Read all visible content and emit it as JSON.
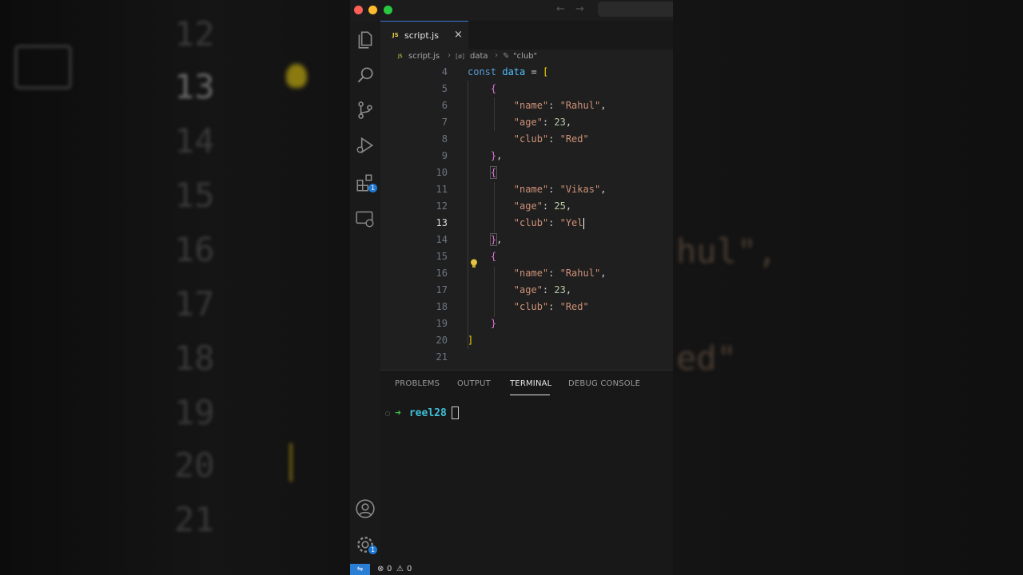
{
  "background": {
    "line_numbers": [
      "12",
      "13",
      "14",
      "15",
      "16",
      "17",
      "18",
      "19",
      "20",
      "21"
    ],
    "fragments": [
      "hul\",",
      "ed\""
    ]
  },
  "window": {
    "tab": {
      "icon_label": "JS",
      "file": "script.js",
      "close": "×"
    },
    "breadcrumb": {
      "file": "script.js",
      "symbol_1": "data",
      "symbol_2": "\"club\""
    },
    "code_lines": [
      {
        "n": "4",
        "active": false
      },
      {
        "n": "5",
        "active": false
      },
      {
        "n": "6",
        "active": false
      },
      {
        "n": "7",
        "active": false
      },
      {
        "n": "8",
        "active": false
      },
      {
        "n": "9",
        "active": false
      },
      {
        "n": "10",
        "active": false
      },
      {
        "n": "11",
        "active": false
      },
      {
        "n": "12",
        "active": false
      },
      {
        "n": "13",
        "active": true
      },
      {
        "n": "14",
        "active": false
      },
      {
        "n": "15",
        "active": false
      },
      {
        "n": "16",
        "active": false
      },
      {
        "n": "17",
        "active": false
      },
      {
        "n": "18",
        "active": false
      },
      {
        "n": "19",
        "active": false
      },
      {
        "n": "20",
        "active": false
      },
      {
        "n": "21",
        "active": false
      }
    ],
    "code": {
      "l4": {
        "kw": "const",
        "var": "data",
        "op": " = ",
        "br": "["
      },
      "l6": {
        "key": "\"name\"",
        "val": "\"Rahul\""
      },
      "l7": {
        "key": "\"age\"",
        "val": "23"
      },
      "l8": {
        "key": "\"club\"",
        "val": "\"Red\""
      },
      "l11": {
        "key": "\"name\"",
        "val": "\"Vikas\""
      },
      "l12": {
        "key": "\"age\"",
        "val": "25"
      },
      "l13": {
        "key": "\"club\"",
        "val": "\"Yel"
      },
      "l16": {
        "key": "\"name\"",
        "val": "\"Rahul\""
      },
      "l17": {
        "key": "\"age\"",
        "val": "23"
      },
      "l18": {
        "key": "\"club\"",
        "val": "\"Red\""
      }
    },
    "panel_tabs": [
      "PROBLEMS",
      "OUTPUT",
      "TERMINAL",
      "DEBUG CONSOLE"
    ],
    "active_panel_tab": "TERMINAL",
    "terminal": {
      "dot": "○",
      "arrow": "➜",
      "directory": "reel28"
    },
    "status": {
      "errors": "0",
      "warnings": "0"
    },
    "colors": {
      "accent": "#2a7fd4",
      "string": "#ce9178",
      "keyword": "#569cd6",
      "variable": "#4fc1ff"
    },
    "icons": [
      "explorer-icon",
      "search-icon",
      "source-control-icon",
      "run-debug-icon",
      "extensions-icon",
      "remote-explorer-icon",
      "account-icon",
      "settings-gear-icon"
    ],
    "extensions_badge": "1",
    "settings_badge": "1"
  }
}
